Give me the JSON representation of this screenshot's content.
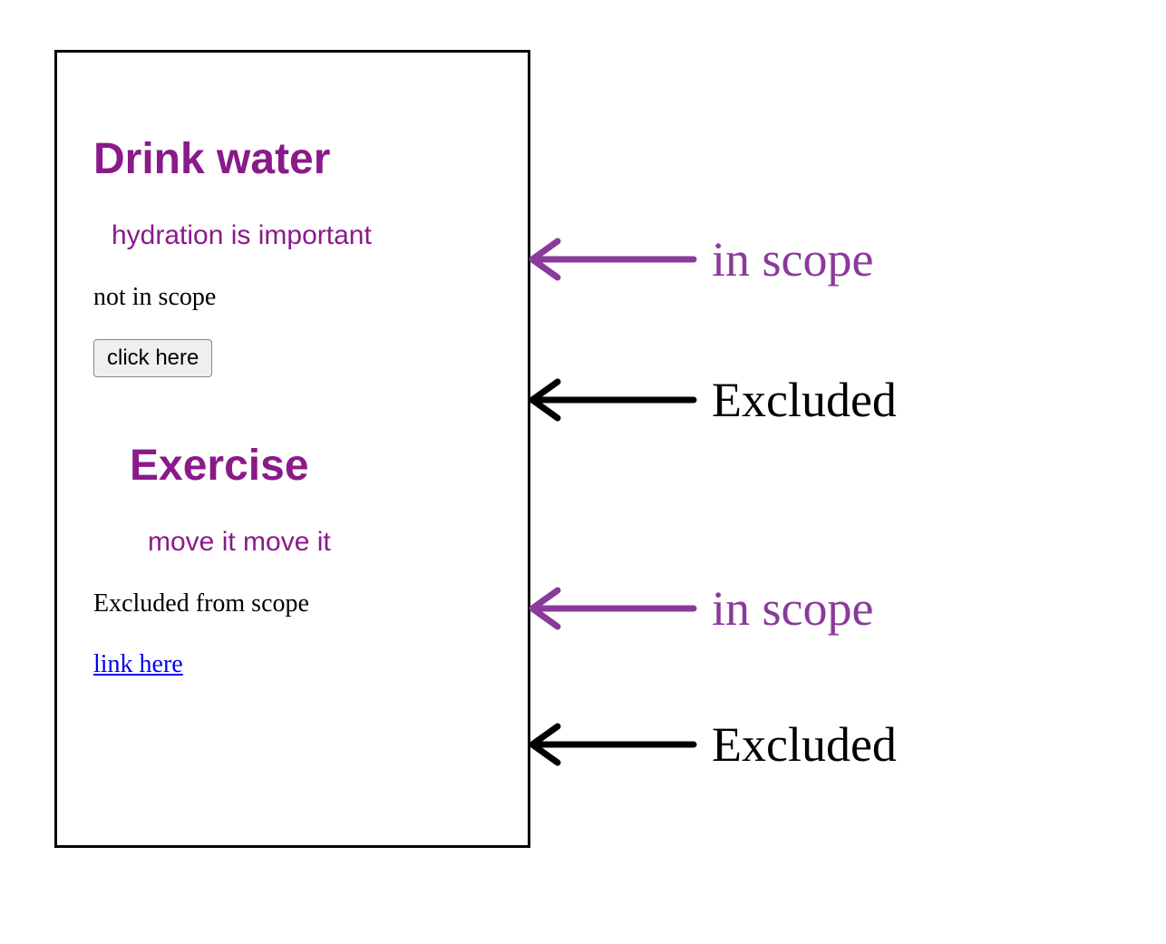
{
  "card": {
    "sections": [
      {
        "heading": "Drink water",
        "sub": "hydration is important",
        "excluded_text": "not in scope",
        "button_label": "click here"
      },
      {
        "heading": "Exercise",
        "sub": "move it move it",
        "excluded_text": "Excluded from scope",
        "link_label": "link here"
      }
    ]
  },
  "annotations": [
    {
      "label": "in scope",
      "color": "purple"
    },
    {
      "label": "Excluded",
      "color": "black"
    },
    {
      "label": "in scope",
      "color": "purple"
    },
    {
      "label": "Excluded",
      "color": "black"
    }
  ],
  "colors": {
    "scope_purple": "#8a1a8a",
    "ann_purple": "#8a3a9a",
    "link_blue": "#0000ee"
  }
}
